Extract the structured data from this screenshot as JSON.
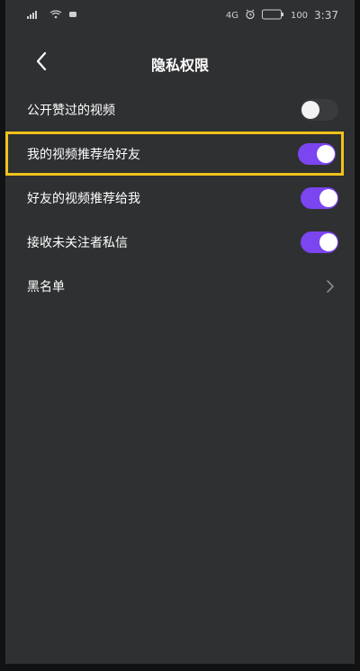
{
  "status_bar": {
    "network_label": "4G",
    "time": "3:37",
    "battery_text": "100"
  },
  "header": {
    "title": "隐私权限"
  },
  "settings": [
    {
      "label": "公开赞过的视频",
      "control": "toggle",
      "on": false
    },
    {
      "label": "我的视频推荐给好友",
      "control": "toggle",
      "on": true
    },
    {
      "label": "好友的视频推荐给我",
      "control": "toggle",
      "on": true
    },
    {
      "label": "接收未关注者私信",
      "control": "toggle",
      "on": true
    },
    {
      "label": "黑名单",
      "control": "chevron"
    }
  ],
  "colors": {
    "background": "#2f3032",
    "toggle_on": "#7b45f0",
    "toggle_off": "#3a3b3d",
    "highlight": "#f0c21b"
  }
}
